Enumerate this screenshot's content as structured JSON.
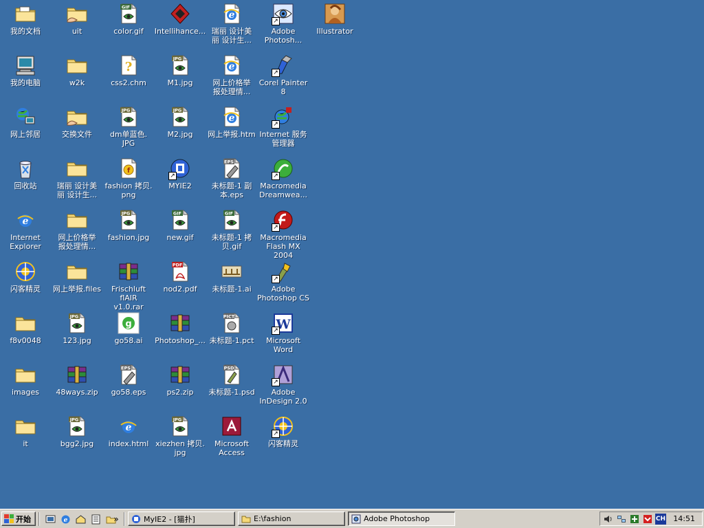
{
  "desktop": {
    "icons": [
      {
        "label": "我的文档",
        "type": "mydocs",
        "col": 0,
        "row": 0,
        "shortcut": false
      },
      {
        "label": "我的电脑",
        "type": "computer",
        "col": 0,
        "row": 1,
        "shortcut": false
      },
      {
        "label": "网上邻居",
        "type": "network",
        "col": 0,
        "row": 2,
        "shortcut": false
      },
      {
        "label": "回收站",
        "type": "recycle",
        "col": 0,
        "row": 3,
        "shortcut": false
      },
      {
        "label": "Internet\nExplorer",
        "type": "ie",
        "col": 0,
        "row": 4,
        "shortcut": false
      },
      {
        "label": "闪客精灵",
        "type": "flashghost",
        "col": 0,
        "row": 5,
        "shortcut": false
      },
      {
        "label": "f8v0048",
        "type": "folder",
        "col": 0,
        "row": 6,
        "shortcut": false
      },
      {
        "label": "images",
        "type": "folder",
        "col": 0,
        "row": 7,
        "shortcut": false
      },
      {
        "label": "it",
        "type": "folder",
        "col": 0,
        "row": 8,
        "shortcut": false
      },
      {
        "label": "uit",
        "type": "folder-shared",
        "col": 1,
        "row": 0,
        "shortcut": false
      },
      {
        "label": "w2k",
        "type": "folder",
        "col": 1,
        "row": 1,
        "shortcut": false
      },
      {
        "label": "交换文件",
        "type": "folder-shared",
        "col": 1,
        "row": 2,
        "shortcut": false
      },
      {
        "label": "瑞丽 设计美\n丽 设计生...",
        "type": "folder",
        "col": 1,
        "row": 3,
        "shortcut": false
      },
      {
        "label": "网上价格举\n报处理情...",
        "type": "folder",
        "col": 1,
        "row": 4,
        "shortcut": false
      },
      {
        "label": "网上举报.files",
        "type": "folder",
        "col": 1,
        "row": 5,
        "shortcut": false
      },
      {
        "label": "123.jpg",
        "type": "jpg",
        "col": 1,
        "row": 6,
        "shortcut": false
      },
      {
        "label": "48ways.zip",
        "type": "zip",
        "col": 1,
        "row": 7,
        "shortcut": false
      },
      {
        "label": "bgg2.jpg",
        "type": "jpg",
        "col": 1,
        "row": 8,
        "shortcut": false
      },
      {
        "label": "color.gif",
        "type": "gif",
        "col": 2,
        "row": 0,
        "shortcut": false
      },
      {
        "label": "css2.chm",
        "type": "chm",
        "col": 2,
        "row": 1,
        "shortcut": false
      },
      {
        "label": "dm单蓝色.\nJPG",
        "type": "jpg",
        "col": 2,
        "row": 2,
        "shortcut": false
      },
      {
        "label": "fashion 拷贝.\npng",
        "type": "png",
        "col": 2,
        "row": 3,
        "shortcut": false
      },
      {
        "label": "fashion.jpg",
        "type": "jpg",
        "col": 2,
        "row": 4,
        "shortcut": false
      },
      {
        "label": "Frischluft flAIR\nv1.0.rar",
        "type": "zip",
        "col": 2,
        "row": 5,
        "shortcut": false
      },
      {
        "label": "go58.ai",
        "type": "ai-go",
        "col": 2,
        "row": 6,
        "shortcut": false
      },
      {
        "label": "go58.eps",
        "type": "eps",
        "col": 2,
        "row": 7,
        "shortcut": false
      },
      {
        "label": "index.html",
        "type": "ie",
        "col": 2,
        "row": 8,
        "shortcut": false
      },
      {
        "label": "Intellihance...",
        "type": "intellihance",
        "col": 3,
        "row": 0,
        "shortcut": false
      },
      {
        "label": "M1.jpg",
        "type": "jpg",
        "col": 3,
        "row": 1,
        "shortcut": false
      },
      {
        "label": "M2.jpg",
        "type": "jpg",
        "col": 3,
        "row": 2,
        "shortcut": false
      },
      {
        "label": "MYIE2",
        "type": "myie",
        "col": 3,
        "row": 3,
        "shortcut": true
      },
      {
        "label": "new.gif",
        "type": "gif",
        "col": 3,
        "row": 4,
        "shortcut": false
      },
      {
        "label": "nod2.pdf",
        "type": "pdf",
        "col": 3,
        "row": 5,
        "shortcut": false
      },
      {
        "label": "Photoshop_...",
        "type": "zip",
        "col": 3,
        "row": 6,
        "shortcut": false
      },
      {
        "label": "ps2.zip",
        "type": "zip",
        "col": 3,
        "row": 7,
        "shortcut": false
      },
      {
        "label": "xiezhen 拷贝.\njpg",
        "type": "jpg",
        "col": 3,
        "row": 8,
        "shortcut": false
      },
      {
        "label": "瑞丽 设计美\n丽 设计生...",
        "type": "ie-doc",
        "col": 4,
        "row": 0,
        "shortcut": false
      },
      {
        "label": "网上价格举\n报处理情...",
        "type": "ie-doc",
        "col": 4,
        "row": 1,
        "shortcut": false
      },
      {
        "label": "网上举报.htm",
        "type": "ie-doc",
        "col": 4,
        "row": 2,
        "shortcut": false
      },
      {
        "label": "未标题-1 副\n本.eps",
        "type": "eps",
        "col": 4,
        "row": 3,
        "shortcut": false
      },
      {
        "label": "未标题-1 拷\n贝.gif",
        "type": "gif",
        "col": 4,
        "row": 4,
        "shortcut": false
      },
      {
        "label": "未标题-1.ai",
        "type": "ai-doc",
        "col": 4,
        "row": 5,
        "shortcut": false
      },
      {
        "label": "未标题-1.pct",
        "type": "pct",
        "col": 4,
        "row": 6,
        "shortcut": false
      },
      {
        "label": "未标题-1.psd",
        "type": "psd",
        "col": 4,
        "row": 7,
        "shortcut": false
      },
      {
        "label": "Microsoft\nAccess",
        "type": "access",
        "col": 4,
        "row": 8,
        "shortcut": false
      },
      {
        "label": "Adobe\nPhotosh...",
        "type": "photoshop-eye",
        "col": 5,
        "row": 0,
        "shortcut": true
      },
      {
        "label": "Corel Painter 8",
        "type": "painter",
        "col": 5,
        "row": 1,
        "shortcut": true
      },
      {
        "label": "Internet 服务\n管理器",
        "type": "iis",
        "col": 5,
        "row": 2,
        "shortcut": true
      },
      {
        "label": "Macromedia\nDreamwea...",
        "type": "dreamweaver",
        "col": 5,
        "row": 3,
        "shortcut": true
      },
      {
        "label": "Macromedia\nFlash MX 2004",
        "type": "flash",
        "col": 5,
        "row": 4,
        "shortcut": true
      },
      {
        "label": "Adobe\nPhotoshop CS",
        "type": "pscs",
        "col": 5,
        "row": 5,
        "shortcut": true
      },
      {
        "label": "Microsoft\nWord",
        "type": "word",
        "col": 5,
        "row": 6,
        "shortcut": true
      },
      {
        "label": "Adobe\nInDesign 2.0",
        "type": "indesign",
        "col": 5,
        "row": 7,
        "shortcut": true
      },
      {
        "label": "闪客精灵",
        "type": "flashghost",
        "col": 5,
        "row": 8,
        "shortcut": true
      },
      {
        "label": "Illustrator",
        "type": "illustrator",
        "col": 6,
        "row": 0,
        "shortcut": false
      }
    ]
  },
  "taskbar": {
    "start_label": "开始",
    "quick_launch": [
      "desktop-icon",
      "ie-icon",
      "outlook-icon",
      "notepad-icon",
      "folder-icon"
    ],
    "more_label": "»",
    "tasks": [
      {
        "label": "MyIE2 - [猫扑]",
        "icon": "myie",
        "active": false
      },
      {
        "label": "E:\\fashion",
        "icon": "folder",
        "active": false
      },
      {
        "label": "Adobe Photoshop",
        "icon": "photoshop",
        "active": true
      }
    ],
    "tray": {
      "lang": "CH",
      "clock": "14:51"
    }
  },
  "colors": {
    "desktop": "#3a6ea5",
    "taskbar": "#d4d0c8",
    "folder": "#f6d978"
  }
}
